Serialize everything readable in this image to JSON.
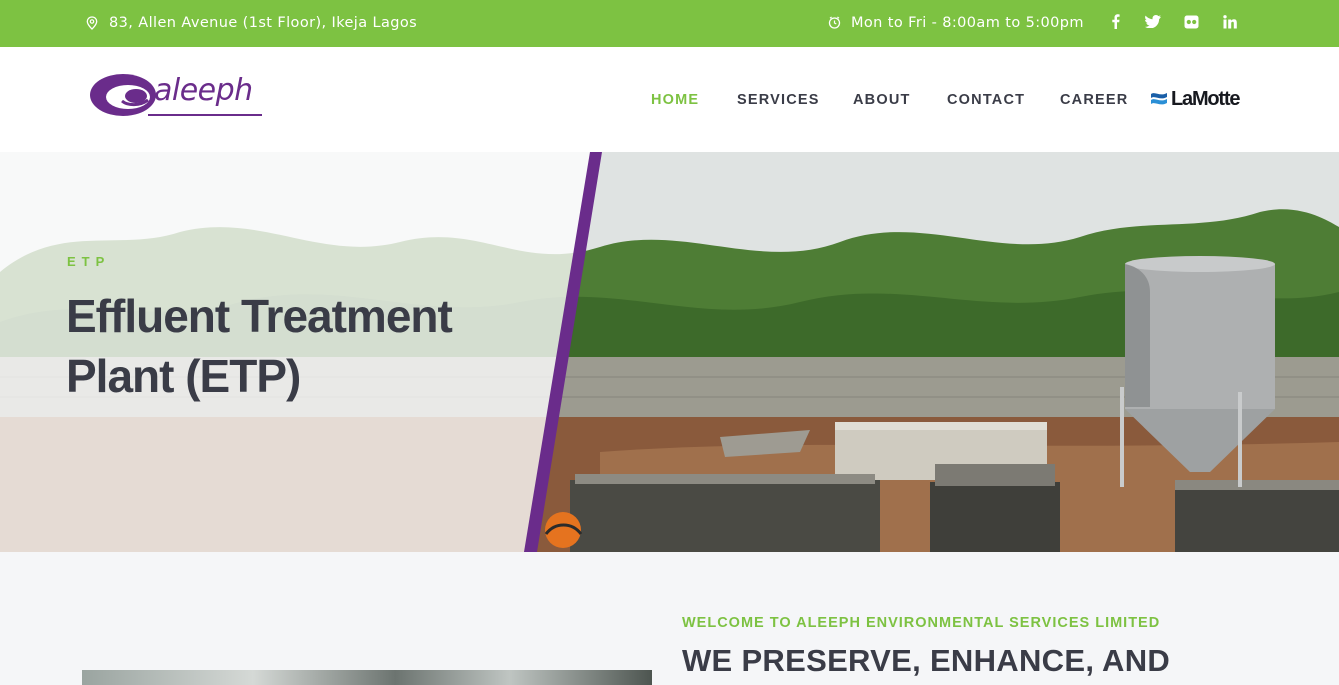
{
  "topbar": {
    "address": "83, Allen Avenue (1st Floor), Ikeja Lagos",
    "hours": "Mon to Fri - 8:00am to 5:00pm",
    "social": [
      "facebook-icon",
      "twitter-icon",
      "flickr-icon",
      "linkedin-icon"
    ],
    "color": "#7dc242"
  },
  "header": {
    "logo_text": "aleeph",
    "nav": [
      "HOME",
      "SERVICES",
      "ABOUT",
      "CONTACT",
      "CAREER"
    ],
    "active_nav": "HOME",
    "partner_logo_text": "LaMotte"
  },
  "hero": {
    "eyebrow": "ETP",
    "title": "Effluent Treatment Plant (ETP)",
    "accent_color": "#6a2c8b"
  },
  "intro": {
    "welcome": "WELCOME TO ALEEPH ENVIRONMENTAL SERVICES LIMITED",
    "headline": "WE PRESERVE, ENHANCE, AND"
  }
}
